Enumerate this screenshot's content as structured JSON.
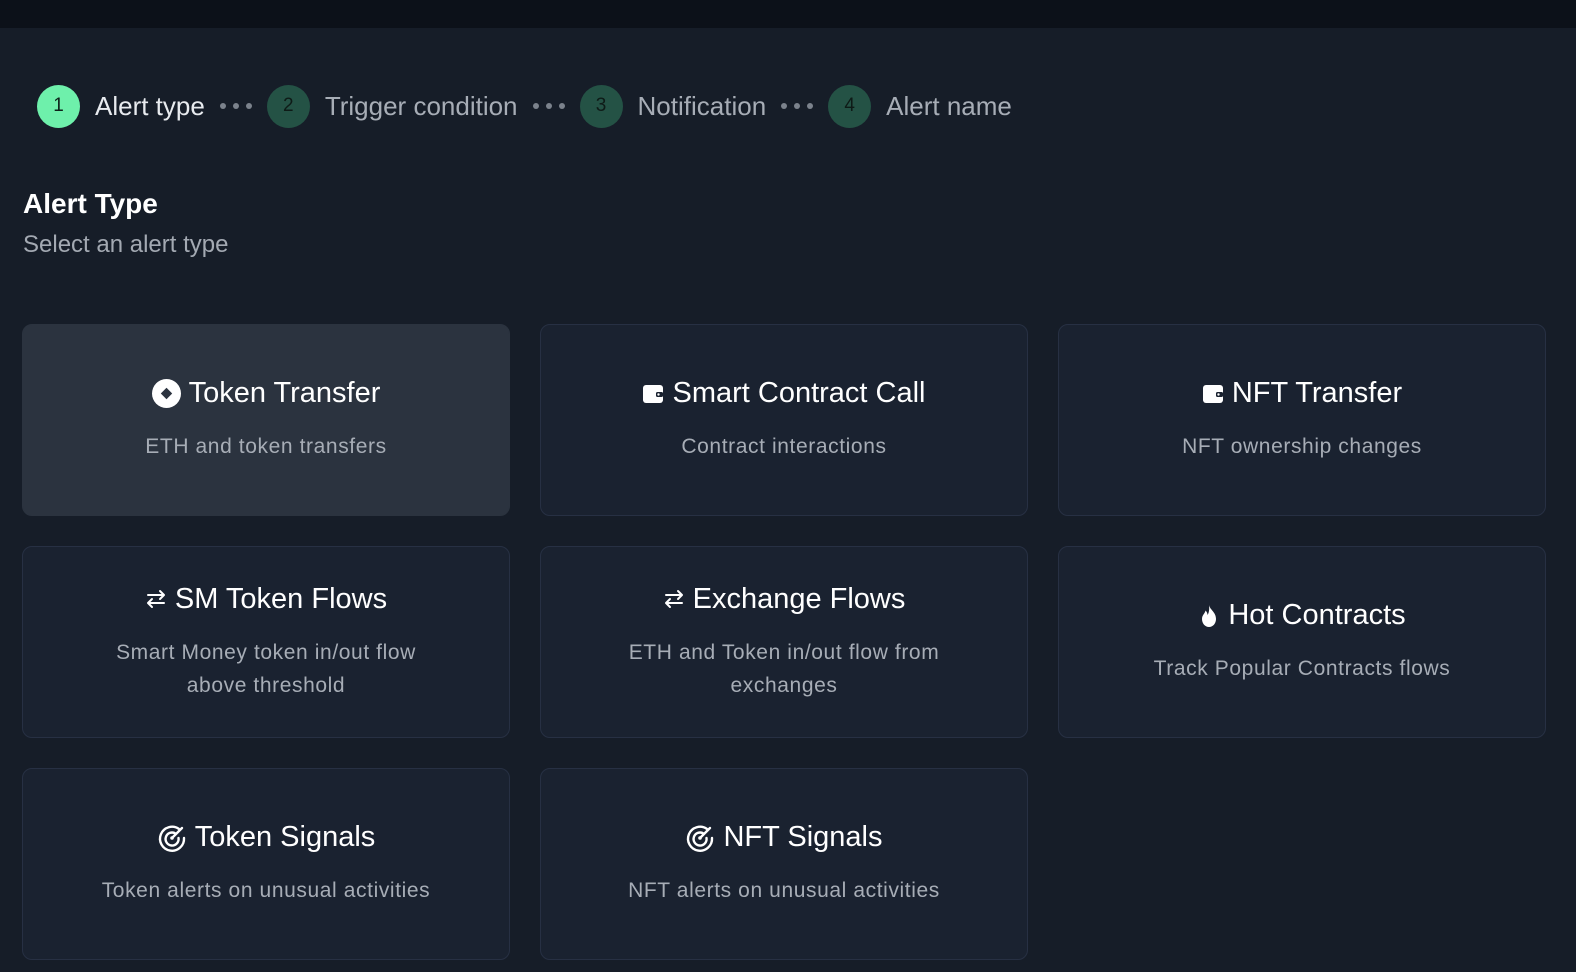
{
  "stepper": {
    "steps": [
      {
        "number": "1",
        "label": "Alert type",
        "active": true
      },
      {
        "number": "2",
        "label": "Trigger condition",
        "active": false
      },
      {
        "number": "3",
        "label": "Notification",
        "active": false
      },
      {
        "number": "4",
        "label": "Alert name",
        "active": false
      }
    ]
  },
  "section": {
    "title": "Alert Type",
    "subtitle": "Select an alert type"
  },
  "cards": [
    {
      "title": "Token Transfer",
      "description": "ETH and token transfers",
      "icon": "token-icon",
      "selected": true
    },
    {
      "title": "Smart Contract Call",
      "description": "Contract interactions",
      "icon": "wallet-icon",
      "selected": false
    },
    {
      "title": "NFT Transfer",
      "description": "NFT ownership changes",
      "icon": "wallet-icon",
      "selected": false
    },
    {
      "title": "SM Token Flows",
      "description": "Smart Money token in/out flow above threshold",
      "icon": "swap-arrows-icon",
      "selected": false
    },
    {
      "title": "Exchange Flows",
      "description": "ETH and Token in/out flow from exchanges",
      "icon": "swap-arrows-icon",
      "selected": false
    },
    {
      "title": "Hot Contracts",
      "description": "Track Popular Contracts flows",
      "icon": "fire-icon",
      "selected": false
    },
    {
      "title": "Token Signals",
      "description": "Token alerts on unusual activities",
      "icon": "radar-icon",
      "selected": false
    },
    {
      "title": "NFT Signals",
      "description": "NFT alerts on unusual activities",
      "icon": "radar-icon",
      "selected": false
    }
  ],
  "colors": {
    "background": "#161d28",
    "topbar": "#0c1119",
    "card_background": "#1a2230",
    "card_selected_background": "#2b333f",
    "card_border": "#273043",
    "step_active": "#6ef0ab",
    "step_inactive": "#245245"
  }
}
